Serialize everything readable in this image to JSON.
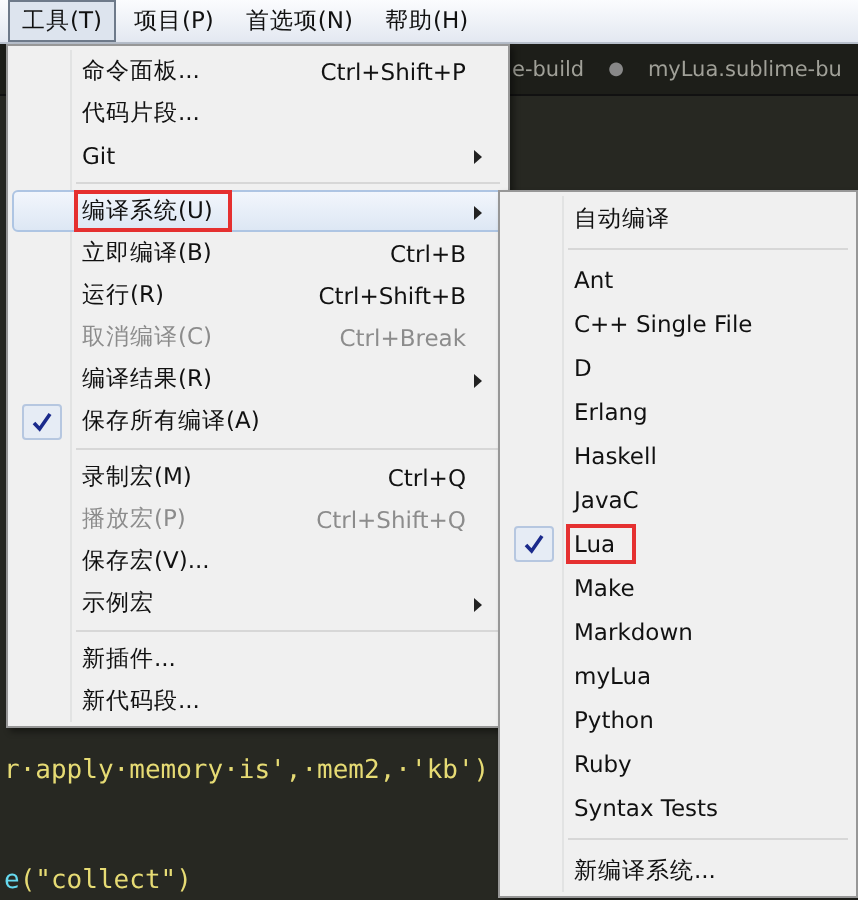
{
  "menubar": [
    {
      "label": "工具(T)",
      "selected": true
    },
    {
      "label": "项目(P)",
      "selected": false
    },
    {
      "label": "首选项(N)",
      "selected": false
    },
    {
      "label": "帮助(H)",
      "selected": false
    }
  ],
  "tabs": [
    {
      "label": "e-build",
      "kind": "tab"
    },
    {
      "label": "●",
      "kind": "dot"
    },
    {
      "label": "myLua.sublime-bu",
      "kind": "tab"
    }
  ],
  "code_lines": [
    {
      "parts": [
        {
          "text": "r·apply·memory·is',·mem2,·'kb')",
          "color": "#e6db74"
        }
      ]
    },
    {
      "parts": [
        {
          "text": "e",
          "color": "#66d9ef"
        },
        {
          "text": "(\"collect\")",
          "color": "#e6db74"
        }
      ]
    }
  ],
  "tools_menu": [
    {
      "kind": "item",
      "label": "命令面板...",
      "shortcut": "Ctrl+Shift+P",
      "submenu": false,
      "disabled": false,
      "checked": false,
      "selected": false,
      "annotated": false
    },
    {
      "kind": "item",
      "label": "代码片段...",
      "submenu": false,
      "disabled": false,
      "checked": false,
      "selected": false,
      "annotated": false
    },
    {
      "kind": "item",
      "label": "Git",
      "submenu": true,
      "disabled": false,
      "checked": false,
      "selected": false,
      "annotated": false
    },
    {
      "kind": "separator"
    },
    {
      "kind": "item",
      "label": "编译系统(U)",
      "submenu": true,
      "disabled": false,
      "checked": false,
      "selected": true,
      "annotated": true
    },
    {
      "kind": "item",
      "label": "立即编译(B)",
      "shortcut": "Ctrl+B",
      "submenu": false,
      "disabled": false,
      "checked": false,
      "selected": false,
      "annotated": false
    },
    {
      "kind": "item",
      "label": "运行(R)",
      "shortcut": "Ctrl+Shift+B",
      "submenu": false,
      "disabled": false,
      "checked": false,
      "selected": false,
      "annotated": false
    },
    {
      "kind": "item",
      "label": "取消编译(C)",
      "shortcut": "Ctrl+Break",
      "submenu": false,
      "disabled": true,
      "checked": false,
      "selected": false,
      "annotated": false
    },
    {
      "kind": "item",
      "label": "编译结果(R)",
      "submenu": true,
      "disabled": false,
      "checked": false,
      "selected": false,
      "annotated": false
    },
    {
      "kind": "item",
      "label": "保存所有编译(A)",
      "submenu": false,
      "disabled": false,
      "checked": true,
      "selected": false,
      "annotated": false
    },
    {
      "kind": "separator"
    },
    {
      "kind": "item",
      "label": "录制宏(M)",
      "shortcut": "Ctrl+Q",
      "submenu": false,
      "disabled": false,
      "checked": false,
      "selected": false,
      "annotated": false
    },
    {
      "kind": "item",
      "label": "播放宏(P)",
      "shortcut": "Ctrl+Shift+Q",
      "submenu": false,
      "disabled": true,
      "checked": false,
      "selected": false,
      "annotated": false
    },
    {
      "kind": "item",
      "label": "保存宏(V)...",
      "submenu": false,
      "disabled": false,
      "checked": false,
      "selected": false,
      "annotated": false
    },
    {
      "kind": "item",
      "label": "示例宏",
      "submenu": true,
      "disabled": false,
      "checked": false,
      "selected": false,
      "annotated": false
    },
    {
      "kind": "separator"
    },
    {
      "kind": "item",
      "label": "新插件...",
      "submenu": false,
      "disabled": false,
      "checked": false,
      "selected": false,
      "annotated": false
    },
    {
      "kind": "item",
      "label": "新代码段...",
      "submenu": false,
      "disabled": false,
      "checked": false,
      "selected": false,
      "annotated": false
    }
  ],
  "build_system_menu": [
    {
      "kind": "item",
      "label": "自动编译",
      "checked": false,
      "annotated": false
    },
    {
      "kind": "separator"
    },
    {
      "kind": "item",
      "label": "Ant",
      "checked": false,
      "annotated": false
    },
    {
      "kind": "item",
      "label": "C++ Single File",
      "checked": false,
      "annotated": false
    },
    {
      "kind": "item",
      "label": "D",
      "checked": false,
      "annotated": false
    },
    {
      "kind": "item",
      "label": "Erlang",
      "checked": false,
      "annotated": false
    },
    {
      "kind": "item",
      "label": "Haskell",
      "checked": false,
      "annotated": false
    },
    {
      "kind": "item",
      "label": "JavaC",
      "checked": false,
      "annotated": false
    },
    {
      "kind": "item",
      "label": "Lua",
      "checked": true,
      "annotated": true
    },
    {
      "kind": "item",
      "label": "Make",
      "checked": false,
      "annotated": false
    },
    {
      "kind": "item",
      "label": "Markdown",
      "checked": false,
      "annotated": false
    },
    {
      "kind": "item",
      "label": "myLua",
      "checked": false,
      "annotated": false
    },
    {
      "kind": "item",
      "label": "Python",
      "checked": false,
      "annotated": false
    },
    {
      "kind": "item",
      "label": "Ruby",
      "checked": false,
      "annotated": false
    },
    {
      "kind": "item",
      "label": "Syntax Tests",
      "checked": false,
      "annotated": false
    },
    {
      "kind": "separator"
    },
    {
      "kind": "item",
      "label": "新编译系统...",
      "checked": false,
      "annotated": false
    }
  ]
}
